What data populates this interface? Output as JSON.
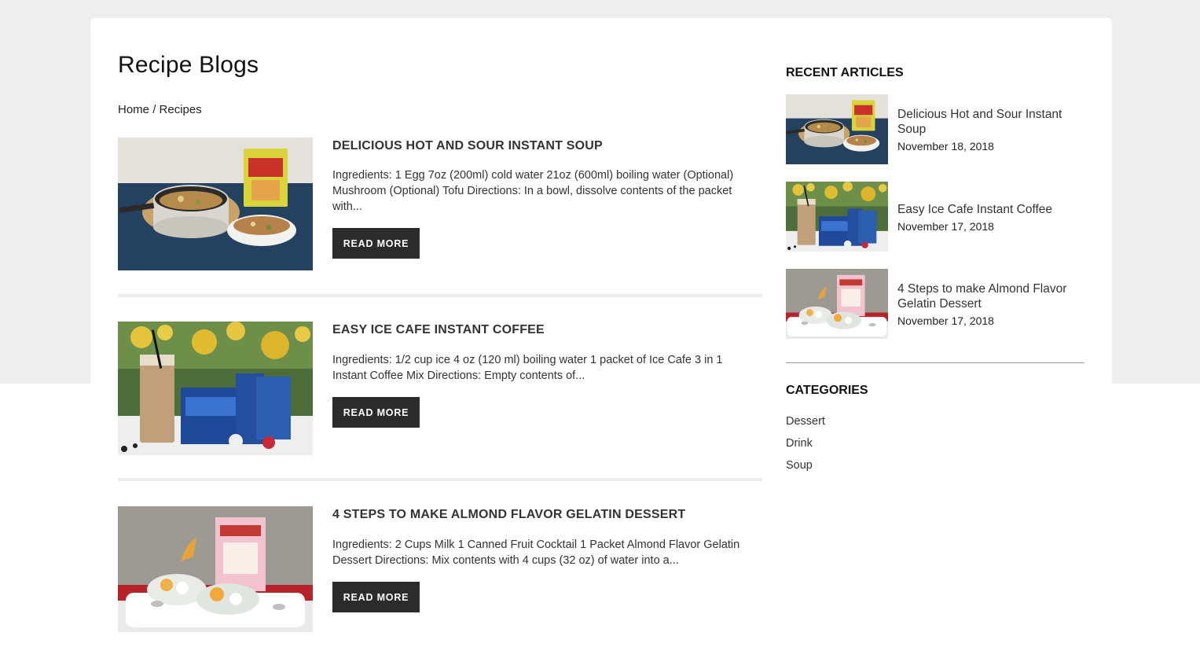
{
  "page": {
    "title": "Recipe Blogs"
  },
  "breadcrumb": {
    "home": "Home",
    "separator": "/",
    "current": "Recipes"
  },
  "posts": [
    {
      "title": "Delicious Hot and Sour Instant Soup",
      "excerpt": "Ingredients: 1 Egg 7oz (200ml) cold water 21oz (600ml) boiling water (Optional) Mushroom (Optional) Tofu Directions: In a bowl, dissolve contents of the packet with...",
      "button": "Read More",
      "image": "soup-photo"
    },
    {
      "title": "Easy Ice Cafe Instant Coffee",
      "excerpt": "Ingredients: 1/2 cup ice 4 oz (120 ml) boiling water 1 packet of Ice Cafe 3 in 1 Instant Coffee Mix Directions: Empty contents of...",
      "button": "Read More",
      "image": "coffee-photo"
    },
    {
      "title": "4 Steps to make Almond Flavor Gelatin Dessert",
      "excerpt": "Ingredients: 2 Cups Milk 1 Canned Fruit Cocktail 1 Packet Almond Flavor Gelatin Dessert Directions: Mix contents with 4 cups (32 oz) of water into a...",
      "button": "Read More",
      "image": "dessert-photo"
    }
  ],
  "sidebar": {
    "recent_heading": "Recent Articles",
    "recent": [
      {
        "title": "Delicious Hot and Sour Instant Soup",
        "date": "November 18, 2018"
      },
      {
        "title": "Easy Ice Cafe Instant Coffee",
        "date": "November 17, 2018"
      },
      {
        "title": "4 Steps to make Almond Flavor Gelatin Dessert",
        "date": "November 17, 2018"
      }
    ],
    "categories_heading": "Categories",
    "categories": [
      "Dessert",
      "Drink",
      "Soup"
    ]
  },
  "colors": {
    "button_bg": "#2b2b2b",
    "page_bg": "#eeeeee",
    "card_bg": "#ffffff"
  }
}
